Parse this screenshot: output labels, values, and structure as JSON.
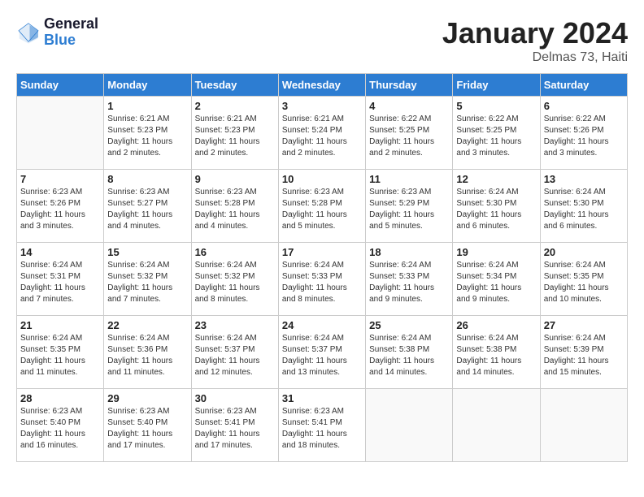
{
  "header": {
    "logo_line1": "General",
    "logo_line2": "Blue",
    "month_title": "January 2024",
    "subtitle": "Delmas 73, Haiti"
  },
  "days_of_week": [
    "Sunday",
    "Monday",
    "Tuesday",
    "Wednesday",
    "Thursday",
    "Friday",
    "Saturday"
  ],
  "weeks": [
    [
      {
        "day": "",
        "info": ""
      },
      {
        "day": "1",
        "info": "Sunrise: 6:21 AM\nSunset: 5:23 PM\nDaylight: 11 hours\nand 2 minutes."
      },
      {
        "day": "2",
        "info": "Sunrise: 6:21 AM\nSunset: 5:23 PM\nDaylight: 11 hours\nand 2 minutes."
      },
      {
        "day": "3",
        "info": "Sunrise: 6:21 AM\nSunset: 5:24 PM\nDaylight: 11 hours\nand 2 minutes."
      },
      {
        "day": "4",
        "info": "Sunrise: 6:22 AM\nSunset: 5:25 PM\nDaylight: 11 hours\nand 2 minutes."
      },
      {
        "day": "5",
        "info": "Sunrise: 6:22 AM\nSunset: 5:25 PM\nDaylight: 11 hours\nand 3 minutes."
      },
      {
        "day": "6",
        "info": "Sunrise: 6:22 AM\nSunset: 5:26 PM\nDaylight: 11 hours\nand 3 minutes."
      }
    ],
    [
      {
        "day": "7",
        "info": "Sunrise: 6:23 AM\nSunset: 5:26 PM\nDaylight: 11 hours\nand 3 minutes."
      },
      {
        "day": "8",
        "info": "Sunrise: 6:23 AM\nSunset: 5:27 PM\nDaylight: 11 hours\nand 4 minutes."
      },
      {
        "day": "9",
        "info": "Sunrise: 6:23 AM\nSunset: 5:28 PM\nDaylight: 11 hours\nand 4 minutes."
      },
      {
        "day": "10",
        "info": "Sunrise: 6:23 AM\nSunset: 5:28 PM\nDaylight: 11 hours\nand 5 minutes."
      },
      {
        "day": "11",
        "info": "Sunrise: 6:23 AM\nSunset: 5:29 PM\nDaylight: 11 hours\nand 5 minutes."
      },
      {
        "day": "12",
        "info": "Sunrise: 6:24 AM\nSunset: 5:30 PM\nDaylight: 11 hours\nand 6 minutes."
      },
      {
        "day": "13",
        "info": "Sunrise: 6:24 AM\nSunset: 5:30 PM\nDaylight: 11 hours\nand 6 minutes."
      }
    ],
    [
      {
        "day": "14",
        "info": "Sunrise: 6:24 AM\nSunset: 5:31 PM\nDaylight: 11 hours\nand 7 minutes."
      },
      {
        "day": "15",
        "info": "Sunrise: 6:24 AM\nSunset: 5:32 PM\nDaylight: 11 hours\nand 7 minutes."
      },
      {
        "day": "16",
        "info": "Sunrise: 6:24 AM\nSunset: 5:32 PM\nDaylight: 11 hours\nand 8 minutes."
      },
      {
        "day": "17",
        "info": "Sunrise: 6:24 AM\nSunset: 5:33 PM\nDaylight: 11 hours\nand 8 minutes."
      },
      {
        "day": "18",
        "info": "Sunrise: 6:24 AM\nSunset: 5:33 PM\nDaylight: 11 hours\nand 9 minutes."
      },
      {
        "day": "19",
        "info": "Sunrise: 6:24 AM\nSunset: 5:34 PM\nDaylight: 11 hours\nand 9 minutes."
      },
      {
        "day": "20",
        "info": "Sunrise: 6:24 AM\nSunset: 5:35 PM\nDaylight: 11 hours\nand 10 minutes."
      }
    ],
    [
      {
        "day": "21",
        "info": "Sunrise: 6:24 AM\nSunset: 5:35 PM\nDaylight: 11 hours\nand 11 minutes."
      },
      {
        "day": "22",
        "info": "Sunrise: 6:24 AM\nSunset: 5:36 PM\nDaylight: 11 hours\nand 11 minutes."
      },
      {
        "day": "23",
        "info": "Sunrise: 6:24 AM\nSunset: 5:37 PM\nDaylight: 11 hours\nand 12 minutes."
      },
      {
        "day": "24",
        "info": "Sunrise: 6:24 AM\nSunset: 5:37 PM\nDaylight: 11 hours\nand 13 minutes."
      },
      {
        "day": "25",
        "info": "Sunrise: 6:24 AM\nSunset: 5:38 PM\nDaylight: 11 hours\nand 14 minutes."
      },
      {
        "day": "26",
        "info": "Sunrise: 6:24 AM\nSunset: 5:38 PM\nDaylight: 11 hours\nand 14 minutes."
      },
      {
        "day": "27",
        "info": "Sunrise: 6:24 AM\nSunset: 5:39 PM\nDaylight: 11 hours\nand 15 minutes."
      }
    ],
    [
      {
        "day": "28",
        "info": "Sunrise: 6:23 AM\nSunset: 5:40 PM\nDaylight: 11 hours\nand 16 minutes."
      },
      {
        "day": "29",
        "info": "Sunrise: 6:23 AM\nSunset: 5:40 PM\nDaylight: 11 hours\nand 17 minutes."
      },
      {
        "day": "30",
        "info": "Sunrise: 6:23 AM\nSunset: 5:41 PM\nDaylight: 11 hours\nand 17 minutes."
      },
      {
        "day": "31",
        "info": "Sunrise: 6:23 AM\nSunset: 5:41 PM\nDaylight: 11 hours\nand 18 minutes."
      },
      {
        "day": "",
        "info": ""
      },
      {
        "day": "",
        "info": ""
      },
      {
        "day": "",
        "info": ""
      }
    ]
  ]
}
